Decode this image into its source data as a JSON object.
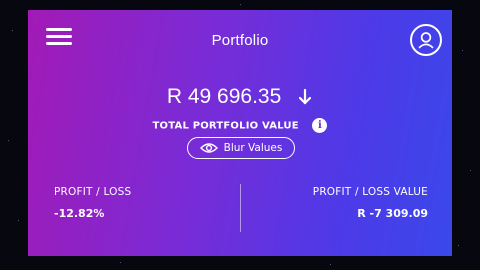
{
  "header": {
    "title": "Portfolio"
  },
  "portfolio": {
    "value": "R 49 696.35",
    "value_label": "TOTAL PORTFOLIO VALUE",
    "blur_button_label": "Blur Values"
  },
  "stats": {
    "profit_loss_label": "PROFIT / LOSS",
    "profit_loss_value": "-12.82%",
    "profit_loss_value_label": "PROFIT / LOSS VALUE",
    "profit_loss_value_amount": "R -7 309.09"
  },
  "icons": {
    "menu": "hamburger-menu-icon",
    "profile": "user-profile-icon",
    "trend": "arrow-down-icon",
    "info": "info-icon",
    "eye": "eye-icon"
  },
  "colors": {
    "gradient_start": "#a21ab6",
    "gradient_end": "#3a48ea",
    "text": "#ffffff",
    "background": "#07080f"
  }
}
